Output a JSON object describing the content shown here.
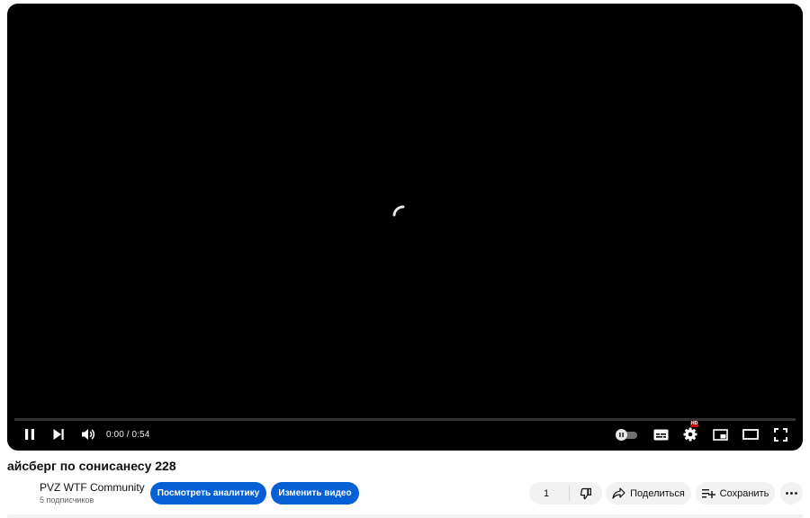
{
  "player": {
    "time_display": "0:00 / 0:54",
    "progress_fraction": 0,
    "hd_badge": "HD"
  },
  "video": {
    "title": "айсберг по сонисанесу 228"
  },
  "channel": {
    "name": "PVZ WTF Community",
    "subscribers": "5 подписчиков"
  },
  "actions": {
    "analytics_label": "Посмотреть аналитику",
    "edit_label": "Изменить видео",
    "like_count": "1",
    "share_label": "Поделиться",
    "save_label": "Сохранить"
  },
  "colors": {
    "accent_blue": "#065fd4",
    "pill_gray": "#f2f2f2",
    "player_bg": "#000000"
  }
}
